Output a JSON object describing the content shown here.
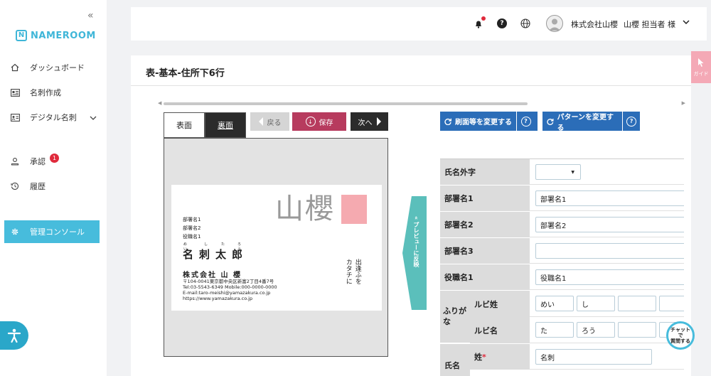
{
  "sidebar": {
    "collapse_icon": "double-chevron-left-icon",
    "logo_mark": "N",
    "logo_text": "NAMEROOM",
    "items": [
      {
        "label": "ダッシュボード",
        "icon": "home-icon"
      },
      {
        "label": "名刺作成",
        "icon": "card-icon"
      },
      {
        "label": "デジタル名刺",
        "icon": "id-card-icon"
      },
      {
        "label": "承認",
        "icon": "person-icon",
        "badge": "1"
      },
      {
        "label": "履歴",
        "icon": "history-icon"
      },
      {
        "label": "管理コンソール",
        "icon": "gear-icon"
      }
    ]
  },
  "header": {
    "company": "株式会社山櫻",
    "user": "山櫻 担当者 様"
  },
  "page": {
    "title": "表-基本-住所下6行",
    "guide_label": "ガイド"
  },
  "editor": {
    "tab_front": "表面",
    "tab_back": "裏面",
    "back_label": "戻る",
    "save_label": "保存",
    "next_label": "次へ",
    "preview_label": "« プレビューに反映"
  },
  "card": {
    "logo_kanji": "山櫻",
    "dept1": "部署名1",
    "dept2": "部署名2",
    "title1": "役職名1",
    "ruby": [
      "めい",
      "し",
      "た",
      "ろう"
    ],
    "name": "名刺太郎",
    "company": "株式会社 山 櫻",
    "address": "〒104-0041東京都中央区新富2丁目4番7号",
    "tel": "Tel:03-5543-6349   Mobile:000-0000-0000",
    "email": "E-mail:taro-meishi@yamazakura.co.jp",
    "url": "https://www.yamazakura.co.jp",
    "vertical1": "出逢ふを",
    "vertical2": "カタチに"
  },
  "actions": {
    "change_face": "刷面等を変更する",
    "change_pattern": "パターンを変更する",
    "help": "?"
  },
  "form": {
    "rows": [
      {
        "label": "氏名外字",
        "value": ""
      },
      {
        "label": "部署名1",
        "value": "部署名1"
      },
      {
        "label": "部署名2",
        "value": "部署名2"
      },
      {
        "label": "部署名3",
        "value": ""
      },
      {
        "label": "役職名1",
        "value": "役職名1"
      }
    ],
    "furigana_label": "ふりがな",
    "ruby_sei_label": "ルビ姓",
    "ruby_sei_values": [
      "めい",
      "し",
      "",
      ""
    ],
    "ruby_mei_label": "ルビ名",
    "ruby_mei_values": [
      "た",
      "ろう",
      "",
      ""
    ],
    "name_label": "氏名",
    "sei_label": "姓",
    "required_mark": "*",
    "sei_value": "名刺"
  },
  "chat": {
    "line1": "チャットで",
    "line2": "質問する"
  }
}
